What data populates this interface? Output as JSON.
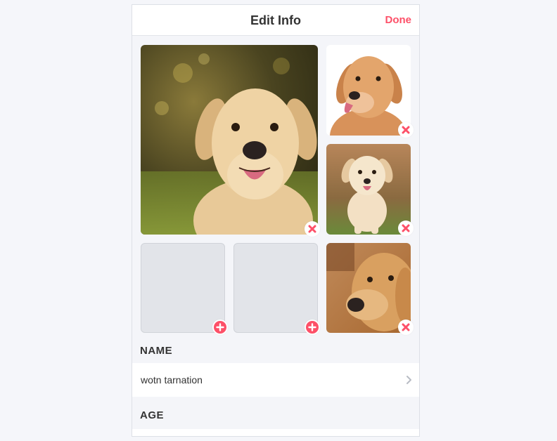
{
  "header": {
    "title": "Edit Info",
    "done_label": "Done"
  },
  "photos": [
    {
      "slot": 1,
      "subject": "labrador-large",
      "action": "remove"
    },
    {
      "slot": 2,
      "subject": "golden-retriever",
      "action": "remove"
    },
    {
      "slot": 3,
      "subject": "puppy-running",
      "action": "remove"
    },
    {
      "slot": 4,
      "subject": "empty",
      "action": "add"
    },
    {
      "slot": 5,
      "subject": "empty",
      "action": "add"
    },
    {
      "slot": 6,
      "subject": "golden-closeup",
      "action": "remove"
    }
  ],
  "name": {
    "label": "NAME",
    "value": "wotn tarnation"
  },
  "age": {
    "label": "AGE"
  },
  "colors": {
    "accent": "#fd5068",
    "empty_slot": "#e2e4e9",
    "background": "#f4f5f9"
  },
  "icons": {
    "remove": "close-x-icon",
    "add": "plus-circle-icon",
    "chevron": "chevron-right-icon"
  }
}
